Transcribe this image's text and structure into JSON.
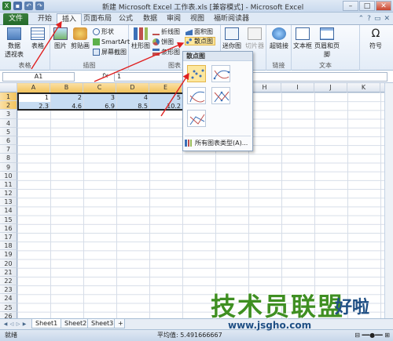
{
  "window": {
    "title": "新建 Microsoft Excel 工作表.xls [兼容模式] - Microsoft Excel",
    "controls": [
      "–",
      "□",
      "✕"
    ]
  },
  "tabs": [
    {
      "label": "文件"
    },
    {
      "label": "开始"
    },
    {
      "label": "插入"
    },
    {
      "label": "页面布局"
    },
    {
      "label": "公式"
    },
    {
      "label": "数据"
    },
    {
      "label": "审阅"
    },
    {
      "label": "视图"
    },
    {
      "label": "福昕阅读器"
    }
  ],
  "ribbon": {
    "groups": {
      "tables": "表格",
      "illustrations": "插图",
      "charts": "图表",
      "links": "链接",
      "text": "文本"
    },
    "pivot": "数据\n透视表",
    "table": "表格",
    "picture": "图片",
    "clipart": "剪贴画",
    "shapes": "形状",
    "smartart": "SmartArt",
    "screenshot": "屏幕截图",
    "column": "柱形图",
    "line": "折线图",
    "pie": "饼图",
    "bar": "条形图",
    "area": "面积图",
    "scatter": "散点图",
    "sparkline_line": "迷你图",
    "slicer": "切片器",
    "hyperlink": "超链接",
    "textbox": "文本框",
    "header_footer": "页眉和页脚",
    "symbol": "符号"
  },
  "scatter_menu": {
    "title": "散点图",
    "all_types": "所有图表类型(A)..."
  },
  "formula": {
    "name_box": "A1",
    "fx": "fx",
    "value": "1"
  },
  "columns": [
    "A",
    "B",
    "C",
    "D",
    "E",
    "F",
    "G",
    "H",
    "I",
    "J",
    "K"
  ],
  "rows": [
    "1",
    "2",
    "3",
    "4",
    "5",
    "6",
    "7",
    "8",
    "9",
    "10",
    "11",
    "12",
    "13",
    "14",
    "15",
    "16",
    "17",
    "18",
    "19",
    "20",
    "21",
    "22",
    "23",
    "24",
    "25",
    "26"
  ],
  "cells": [
    [
      "1",
      "2",
      "3",
      "4",
      "5"
    ],
    [
      "2.3",
      "4.6",
      "6.9",
      "8.5",
      "10.2"
    ]
  ],
  "sheets": [
    "Sheet1",
    "Sheet2",
    "Sheet3"
  ],
  "status": {
    "ready": "就绪",
    "average": "平均值: 5.491666667"
  },
  "watermark": {
    "main": "技术员联盟",
    "suffix": "好啦",
    "url": "www.jsgho.com"
  },
  "colors": {
    "file_tab": "#2e7b34",
    "selection": "#c7dcf2",
    "highlight": "#fde79d",
    "arrow": "#e02020"
  }
}
